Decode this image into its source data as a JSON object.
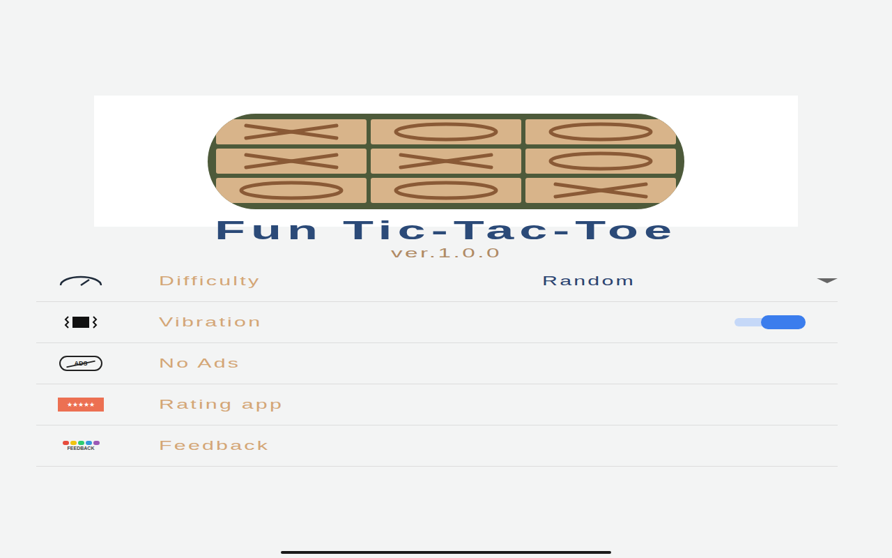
{
  "app": {
    "title": "Fun Tic-Tac-Toe",
    "version": "ver.1.0.0"
  },
  "settings": [
    {
      "kind": "dropdown",
      "label": "Difficulty",
      "value": "Random"
    },
    {
      "kind": "toggle",
      "label": "Vibration",
      "on": true
    },
    {
      "kind": "link",
      "label": "No Ads",
      "icon_text": "ADS"
    },
    {
      "kind": "link",
      "label": "Rating app",
      "icon_text": "★★★★★"
    },
    {
      "kind": "link",
      "label": "Feedback",
      "icon_text": "FEEDBACK"
    }
  ]
}
